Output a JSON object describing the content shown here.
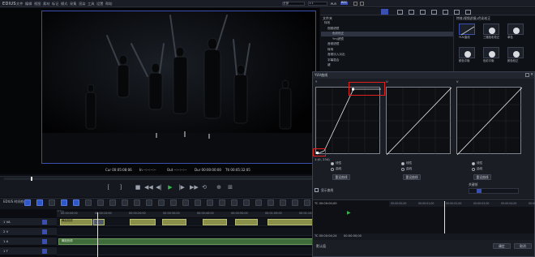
{
  "app": {
    "name": "EDIUS",
    "menu": [
      "文件",
      "编辑",
      "视图",
      "素材",
      "标记",
      "模式",
      "采集",
      "渲染",
      "工具",
      "设置",
      "帮助"
    ],
    "project_preset": "全部",
    "play_mode": "1:1",
    "badge": "PLR",
    "badge2": "REC"
  },
  "viewer": {
    "cur_label": "Cur",
    "cur_value": "00:05:08:06",
    "in_label": "In",
    "in_value": "--:--:--:--",
    "out_label": "Out",
    "out_value": "--:--:--:--",
    "dur_label": "Dur",
    "dur_value": "00:00:00:00",
    "ttl_label": "Ttl",
    "ttl_value": "00:05:32:05"
  },
  "timeline": {
    "sequence_label": "序列1",
    "ruler_ticks": [
      "00:00:00:00",
      "00:00:10:00",
      "00:00:20:00",
      "00:00:30:00",
      "00:00:40:00",
      "00:00:50:00",
      "00:01:00:00",
      "00:01:10:00"
    ],
    "tracks": [
      {
        "name": "1 VA",
        "clip": "舞蹈视频"
      },
      {
        "name": "2 V",
        "clip": ""
      },
      {
        "name": "1 A",
        "clip": "舞蹈音频"
      },
      {
        "name": "1 T",
        "clip": ""
      }
    ],
    "header_label": "EDIUS",
    "header_sub": "时间线"
  },
  "effects_panel": {
    "tree_title": "文件夹",
    "tree_items": [
      "特效",
      "视频滤镜",
      "色彩校正",
      "Ymj滤镜",
      "音频滤镜",
      "转场",
      "音频淡入淡出",
      "字幕混合",
      "键"
    ],
    "effects_title": "特效(视频滤镜)/色彩校正",
    "effects": [
      "YUV曲线",
      "三路色彩校正",
      "单色",
      "颜色平衡",
      "色彩平衡",
      "颜色校正"
    ]
  },
  "dialog": {
    "title": "YUV曲线",
    "graph_labels": [
      "Y",
      "U",
      "V"
    ],
    "linear_label": "线性",
    "curve_label": "曲线",
    "reset_label": "重设曲线",
    "curve_point": "1:(0, 234)",
    "preview_label": "显示曲线",
    "tc_start": "00:00:00;00",
    "tc_end": "00:00:05;00",
    "keyframe_label": "关键帧",
    "footer_left": "默认值",
    "ok_label": "确定",
    "cancel_label": "取消",
    "tc_readout": "TC 00:00:04;24",
    "tc_readout2": "TC 00:00:00;00",
    "timeline_ticks": [
      "00:00:00;00",
      "00:00:01;00",
      "00:00:02;00",
      "00:00:03;00",
      "00:00:04;00",
      "00:00:05;00"
    ]
  },
  "colors": {
    "accent": "#3a4fb0",
    "highlight": "#e0201f",
    "play": "#3bb54a",
    "clip_video": "#8a8f4a",
    "clip_audio": "#3f6a3a"
  }
}
